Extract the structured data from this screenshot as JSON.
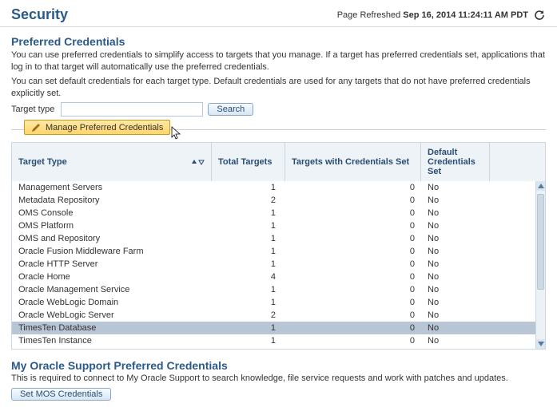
{
  "header": {
    "title": "Security",
    "refreshed_prefix": "Page Refreshed ",
    "refreshed_time": "Sep 16, 2014 11:24:11 AM PDT"
  },
  "preferred": {
    "title": "Preferred Credentials",
    "desc1": "You can use preferred credentials to simplify access to targets that you manage. If a target has preferred credentials set, applications that log in to that target will automatically use the preferred credentials.",
    "desc2": "You can set default credentials for each target type. Default credentials are used for any targets that do not have preferred credentials explicitly set.",
    "filter_label": "Target type",
    "filter_value": "",
    "search_label": "Search",
    "manage_btn": "Manage Preferred Credentials",
    "columns": {
      "type": "Target Type",
      "total": "Total Targets",
      "set": "Targets with Credentials Set",
      "def": "Default Credentials Set"
    },
    "rows": [
      {
        "type": "Management Servers",
        "total": 1,
        "set": 0,
        "def": "No"
      },
      {
        "type": "Metadata Repository",
        "total": 2,
        "set": 0,
        "def": "No"
      },
      {
        "type": "OMS Console",
        "total": 1,
        "set": 0,
        "def": "No"
      },
      {
        "type": "OMS Platform",
        "total": 1,
        "set": 0,
        "def": "No"
      },
      {
        "type": "OMS and Repository",
        "total": 1,
        "set": 0,
        "def": "No"
      },
      {
        "type": "Oracle Fusion Middleware Farm",
        "total": 1,
        "set": 0,
        "def": "No"
      },
      {
        "type": "Oracle HTTP Server",
        "total": 1,
        "set": 0,
        "def": "No"
      },
      {
        "type": "Oracle Home",
        "total": 4,
        "set": 0,
        "def": "No"
      },
      {
        "type": "Oracle Management Service",
        "total": 1,
        "set": 0,
        "def": "No"
      },
      {
        "type": "Oracle WebLogic Domain",
        "total": 1,
        "set": 0,
        "def": "No"
      },
      {
        "type": "Oracle WebLogic Server",
        "total": 2,
        "set": 0,
        "def": "No"
      },
      {
        "type": "TimesTen Database",
        "total": 1,
        "set": 0,
        "def": "No"
      },
      {
        "type": "TimesTen Instance",
        "total": 1,
        "set": 0,
        "def": "No"
      }
    ],
    "selected_index": 11
  },
  "mos": {
    "title": "My Oracle Support Preferred Credentials",
    "desc": "This is required to connect to My Oracle Support to search knowledge, file service requests and work with patches and updates.",
    "button": "Set MOS Credentials"
  }
}
